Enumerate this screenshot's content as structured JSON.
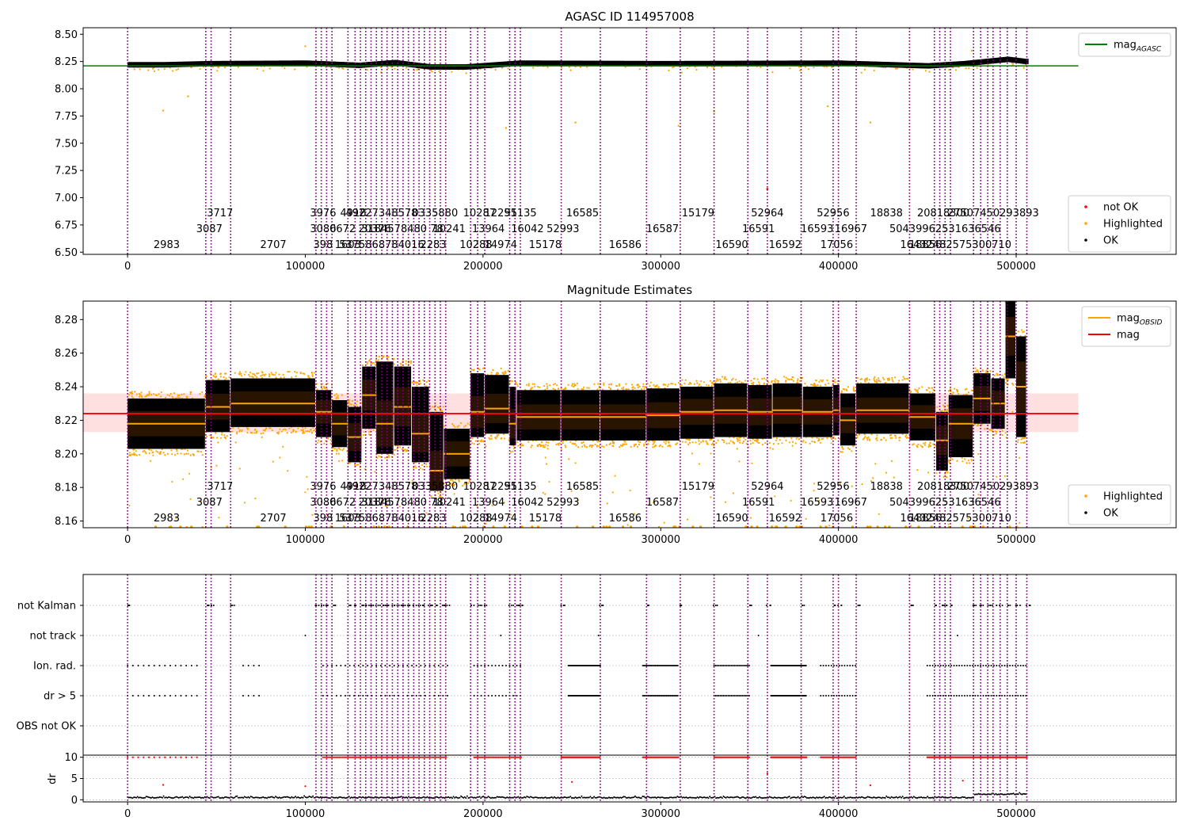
{
  "chart_data": [
    {
      "type": "scatter",
      "title": "AGASC ID 114957008",
      "xlabel": "",
      "ylabel": "",
      "xlim": [
        -25000,
        590000
      ],
      "ylim": [
        6.48,
        8.56
      ],
      "xticks": [
        0,
        100000,
        200000,
        300000,
        400000,
        500000
      ],
      "xtick_labels": [
        "0",
        "100000",
        "200000",
        "300000",
        "400000",
        "500000"
      ],
      "yticks": [
        6.5,
        6.75,
        7.0,
        7.25,
        7.5,
        7.75,
        8.0,
        8.25,
        8.5
      ],
      "ytick_labels": [
        "6.50",
        "6.75",
        "7.00",
        "7.25",
        "7.50",
        "7.75",
        "8.00",
        "8.25",
        "8.50"
      ],
      "legend_top": {
        "placement": "upper right",
        "entries": [
          {
            "label": "mag",
            "sub": "AGASC",
            "color": "#008000",
            "kind": "line"
          }
        ]
      },
      "legend_bottom": {
        "placement": "lower right",
        "entries": [
          {
            "label": "not OK",
            "color": "#ff0000",
            "kind": "dot"
          },
          {
            "label": "Highlighted",
            "color": "#ffa500",
            "kind": "dot"
          },
          {
            "label": "OK",
            "color": "#000000",
            "kind": "dot"
          }
        ]
      },
      "mag_agasc": 8.21,
      "series": [
        {
          "name": "OK",
          "color": "#000000",
          "points": [
            [
              0,
              8.22
            ],
            [
              20000,
              8.22
            ],
            [
              45000,
              8.23
            ],
            [
              100000,
              8.235
            ],
            [
              130000,
              8.215
            ],
            [
              150000,
              8.24
            ],
            [
              170000,
              8.2
            ],
            [
              190000,
              8.2
            ],
            [
              220000,
              8.235
            ],
            [
              300000,
              8.23
            ],
            [
              400000,
              8.235
            ],
            [
              450000,
              8.21
            ],
            [
              470000,
              8.23
            ],
            [
              495000,
              8.27
            ],
            [
              505000,
              8.25
            ]
          ]
        },
        {
          "name": "Highlighted",
          "color": "#ffa500",
          "points": [
            [
              20000,
              7.8
            ],
            [
              34000,
              7.93
            ],
            [
              100000,
              8.39
            ],
            [
              213000,
              7.64
            ],
            [
              252000,
              7.69
            ],
            [
              310000,
              7.66
            ],
            [
              330000,
              7.79
            ],
            [
              394000,
              7.84
            ],
            [
              418000,
              7.69
            ],
            [
              475000,
              8.35
            ]
          ]
        },
        {
          "name": "not OK",
          "color": "#ff0000",
          "points": [
            [
              360000,
              7.08
            ]
          ]
        }
      ]
    },
    {
      "type": "scatter",
      "title": "Magnitude Estimates",
      "xlabel": "",
      "ylabel": "",
      "xlim": [
        -25000,
        590000
      ],
      "ylim": [
        8.156,
        8.291
      ],
      "xticks": [
        0,
        100000,
        200000,
        300000,
        400000,
        500000
      ],
      "xtick_labels": [
        "0",
        "100000",
        "200000",
        "300000",
        "400000",
        "500000"
      ],
      "yticks": [
        8.16,
        8.18,
        8.2,
        8.22,
        8.24,
        8.26,
        8.28
      ],
      "ytick_labels": [
        "8.16",
        "8.18",
        "8.20",
        "8.22",
        "8.24",
        "8.26",
        "8.28"
      ],
      "legend_top": {
        "placement": "upper right",
        "entries": [
          {
            "label": "mag",
            "sub": "OBSID",
            "color": "#ffa500",
            "kind": "line"
          },
          {
            "label": "mag",
            "sub": "",
            "color": "#ff0000",
            "kind": "line"
          }
        ]
      },
      "legend_bottom": {
        "placement": "lower right",
        "entries": [
          {
            "label": "Highlighted",
            "color": "#ffa500",
            "kind": "dot"
          },
          {
            "label": "OK",
            "color": "#000000",
            "kind": "dot"
          }
        ]
      },
      "mag": 8.224,
      "mag_band": [
        8.213,
        8.236
      ],
      "obsid_segments": [
        {
          "x0": 0,
          "x1": 44000,
          "mag": 8.218,
          "lo": 8.203,
          "hi": 8.233
        },
        {
          "x0": 44000,
          "x1": 58000,
          "mag": 8.228,
          "lo": 8.213,
          "hi": 8.244
        },
        {
          "x0": 58000,
          "x1": 106000,
          "mag": 8.23,
          "lo": 8.216,
          "hi": 8.245
        },
        {
          "x0": 106000,
          "x1": 115000,
          "mag": 8.225,
          "lo": 8.21,
          "hi": 8.238
        },
        {
          "x0": 115000,
          "x1": 124000,
          "mag": 8.218,
          "lo": 8.204,
          "hi": 8.232
        },
        {
          "x0": 124000,
          "x1": 132000,
          "mag": 8.21,
          "lo": 8.195,
          "hi": 8.228
        },
        {
          "x0": 132000,
          "x1": 140000,
          "mag": 8.235,
          "lo": 8.215,
          "hi": 8.252
        },
        {
          "x0": 140000,
          "x1": 150000,
          "mag": 8.218,
          "lo": 8.2,
          "hi": 8.255
        },
        {
          "x0": 150000,
          "x1": 160000,
          "mag": 8.228,
          "lo": 8.205,
          "hi": 8.252
        },
        {
          "x0": 160000,
          "x1": 170000,
          "mag": 8.212,
          "lo": 8.195,
          "hi": 8.24
        },
        {
          "x0": 170000,
          "x1": 178000,
          "mag": 8.19,
          "lo": 8.178,
          "hi": 8.225
        },
        {
          "x0": 178000,
          "x1": 193000,
          "mag": 8.2,
          "lo": 8.185,
          "hi": 8.215
        },
        {
          "x0": 193000,
          "x1": 201000,
          "mag": 8.225,
          "lo": 8.21,
          "hi": 8.248
        },
        {
          "x0": 201000,
          "x1": 215000,
          "mag": 8.227,
          "lo": 8.212,
          "hi": 8.247
        },
        {
          "x0": 215000,
          "x1": 219000,
          "mag": 8.218,
          "lo": 8.205,
          "hi": 8.24
        },
        {
          "x0": 219000,
          "x1": 244000,
          "mag": 8.222,
          "lo": 8.208,
          "hi": 8.238
        },
        {
          "x0": 244000,
          "x1": 266000,
          "mag": 8.222,
          "lo": 8.208,
          "hi": 8.238
        },
        {
          "x0": 266000,
          "x1": 292000,
          "mag": 8.222,
          "lo": 8.208,
          "hi": 8.238
        },
        {
          "x0": 292000,
          "x1": 311000,
          "mag": 8.223,
          "lo": 8.208,
          "hi": 8.239
        },
        {
          "x0": 311000,
          "x1": 330000,
          "mag": 8.225,
          "lo": 8.209,
          "hi": 8.24
        },
        {
          "x0": 330000,
          "x1": 349000,
          "mag": 8.226,
          "lo": 8.21,
          "hi": 8.242
        },
        {
          "x0": 349000,
          "x1": 363000,
          "mag": 8.225,
          "lo": 8.209,
          "hi": 8.241
        },
        {
          "x0": 363000,
          "x1": 380000,
          "mag": 8.226,
          "lo": 8.21,
          "hi": 8.242
        },
        {
          "x0": 380000,
          "x1": 397000,
          "mag": 8.225,
          "lo": 8.21,
          "hi": 8.24
        },
        {
          "x0": 397000,
          "x1": 401000,
          "mag": 8.226,
          "lo": 8.211,
          "hi": 8.241
        },
        {
          "x0": 401000,
          "x1": 410000,
          "mag": 8.22,
          "lo": 8.205,
          "hi": 8.236
        },
        {
          "x0": 410000,
          "x1": 440000,
          "mag": 8.226,
          "lo": 8.212,
          "hi": 8.242
        },
        {
          "x0": 440000,
          "x1": 455000,
          "mag": 8.222,
          "lo": 8.208,
          "hi": 8.236
        },
        {
          "x0": 455000,
          "x1": 462000,
          "mag": 8.208,
          "lo": 8.19,
          "hi": 8.225
        },
        {
          "x0": 462000,
          "x1": 476000,
          "mag": 8.218,
          "lo": 8.198,
          "hi": 8.235
        },
        {
          "x0": 476000,
          "x1": 486000,
          "mag": 8.233,
          "lo": 8.218,
          "hi": 8.248
        },
        {
          "x0": 486000,
          "x1": 494000,
          "mag": 8.23,
          "lo": 8.215,
          "hi": 8.245
        },
        {
          "x0": 494000,
          "x1": 500000,
          "mag": 8.27,
          "lo": 8.245,
          "hi": 8.291
        },
        {
          "x0": 500000,
          "x1": 506000,
          "mag": 8.24,
          "lo": 8.21,
          "hi": 8.27
        }
      ]
    },
    {
      "type": "scatter",
      "title": "",
      "xlabel": "",
      "ylabel": "",
      "xlim": [
        -25000,
        590000
      ],
      "categories": [
        "not Kalman",
        "not track",
        "Ion. rad.",
        "dr > 5",
        "OBS not OK"
      ],
      "xticks": [
        0,
        100000,
        200000,
        300000,
        400000,
        500000
      ],
      "xtick_labels": [
        "0",
        "100000",
        "200000",
        "300000",
        "400000",
        "500000"
      ],
      "grid": true
    },
    {
      "type": "scatter",
      "title": "",
      "xlabel": "",
      "ylabel": "dr",
      "xlim": [
        -25000,
        590000
      ],
      "ylim": [
        -0.5,
        10.5
      ],
      "yticks": [
        0,
        5,
        10
      ],
      "ytick_labels": [
        "0",
        "5",
        "10"
      ],
      "xticks": [
        0,
        100000,
        200000,
        300000,
        400000,
        500000
      ],
      "xtick_labels": [
        "0",
        "100000",
        "200000",
        "300000",
        "400000",
        "500000"
      ],
      "grid": true,
      "series": [
        {
          "name": "dr OK",
          "color": "#000000",
          "y_typical": 0.4
        },
        {
          "name": "dr clipped",
          "color": "#ff0000",
          "y": 10
        }
      ]
    }
  ],
  "obsids": {
    "boundaries": [
      0,
      44000,
      47000,
      58000,
      106000,
      109000,
      112000,
      115000,
      124000,
      128000,
      131000,
      134000,
      137000,
      140000,
      143000,
      146000,
      149000,
      152000,
      155000,
      158000,
      161000,
      164000,
      167000,
      170000,
      173000,
      176000,
      179000,
      193000,
      197000,
      201000,
      215000,
      218000,
      221000,
      244000,
      266000,
      292000,
      311000,
      330000,
      349000,
      360000,
      379000,
      397000,
      400000,
      410000,
      440000,
      454000,
      457000,
      460000,
      463000,
      476000,
      480000,
      484000,
      487000,
      491000,
      495000,
      500000,
      506000
    ],
    "labels": [
      {
        "x": 22000,
        "row": 3,
        "text": "2983"
      },
      {
        "x": 52000,
        "row": 1,
        "text": "3717"
      },
      {
        "x": 46000,
        "row": 2,
        "text": "3087"
      },
      {
        "x": 82000,
        "row": 3,
        "text": "2707"
      },
      {
        "x": 110000,
        "row": 1,
        "text": "3976"
      },
      {
        "x": 110000,
        "row": 2,
        "text": "3086"
      },
      {
        "x": 110000,
        "row": 3,
        "text": "398"
      },
      {
        "x": 121000,
        "row": 2,
        "text": "0672"
      },
      {
        "x": 127000,
        "row": 1,
        "text": "4918"
      },
      {
        "x": 124000,
        "row": 3,
        "text": "1603"
      },
      {
        "x": 139000,
        "row": 2,
        "text": "20376"
      },
      {
        "x": 143000,
        "row": 1,
        "text": "49227348578"
      },
      {
        "x": 150000,
        "row": 2,
        "text": "3184578480"
      },
      {
        "x": 143000,
        "row": 3,
        "text": "5375868784016"
      },
      {
        "x": 173000,
        "row": 1,
        "text": "0335880"
      },
      {
        "x": 174000,
        "row": 2,
        "text": "78"
      },
      {
        "x": 172000,
        "row": 3,
        "text": "2283"
      },
      {
        "x": 181000,
        "row": 2,
        "text": "10241"
      },
      {
        "x": 198000,
        "row": 1,
        "text": "10287"
      },
      {
        "x": 203000,
        "row": 2,
        "text": "13964"
      },
      {
        "x": 196000,
        "row": 3,
        "text": "10288"
      },
      {
        "x": 210000,
        "row": 1,
        "text": "12295"
      },
      {
        "x": 210000,
        "row": 3,
        "text": "14974"
      },
      {
        "x": 221000,
        "row": 1,
        "text": "51135"
      },
      {
        "x": 225000,
        "row": 2,
        "text": "16042"
      },
      {
        "x": 235000,
        "row": 3,
        "text": "15178"
      },
      {
        "x": 245000,
        "row": 2,
        "text": "52993"
      },
      {
        "x": 256000,
        "row": 1,
        "text": "16585"
      },
      {
        "x": 280000,
        "row": 3,
        "text": "16586"
      },
      {
        "x": 301000,
        "row": 2,
        "text": "16587"
      },
      {
        "x": 321000,
        "row": 1,
        "text": "15179"
      },
      {
        "x": 340000,
        "row": 3,
        "text": "16590"
      },
      {
        "x": 360000,
        "row": 1,
        "text": "52964"
      },
      {
        "x": 355000,
        "row": 2,
        "text": "16591"
      },
      {
        "x": 370000,
        "row": 3,
        "text": "16592"
      },
      {
        "x": 388000,
        "row": 2,
        "text": "16593"
      },
      {
        "x": 397000,
        "row": 1,
        "text": "52956"
      },
      {
        "x": 407000,
        "row": 2,
        "text": "16967"
      },
      {
        "x": 399000,
        "row": 3,
        "text": "17056"
      },
      {
        "x": 427000,
        "row": 1,
        "text": "18838"
      },
      {
        "x": 449000,
        "row": 3,
        "text": "18856"
      },
      {
        "x": 459000,
        "row": 1,
        "text": "20818300"
      },
      {
        "x": 460000,
        "row": 2,
        "text": "50439962531636546"
      },
      {
        "x": 466000,
        "row": 3,
        "text": "16432482575300710"
      },
      {
        "x": 487000,
        "row": 1,
        "text": "27507450293893"
      }
    ]
  }
}
